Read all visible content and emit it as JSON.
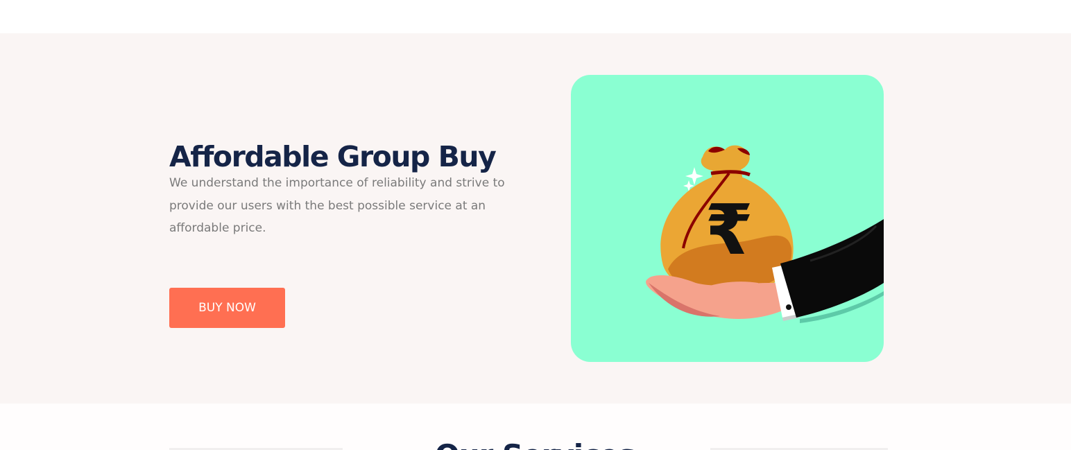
{
  "hero": {
    "title": "Affordable Group Buy",
    "description": "We understand the importance of reliability and strive to provide our users with the best possible service at an affordable price.",
    "button_label": "BUY NOW",
    "illustration_symbol": "₹",
    "illustration": "money-bag-in-hand-icon"
  },
  "services": {
    "title": "Our Services"
  },
  "colors": {
    "title": "#152447",
    "text": "#7a7a7a",
    "button": "#ff6f52",
    "card": "#8affd2",
    "section_bg": "#faf5f4"
  }
}
